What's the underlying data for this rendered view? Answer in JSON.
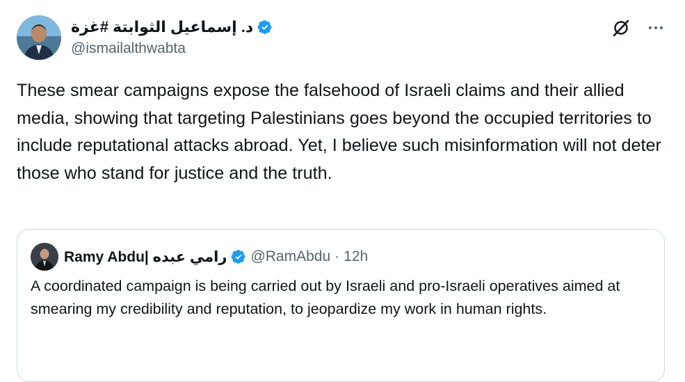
{
  "tweet": {
    "author": {
      "display_name": "د. إسماعيل الثوابتة #غزة",
      "handle": "@ismailalthwabta",
      "verified": true,
      "avatar": "profile-photo"
    },
    "actions": {
      "grok_icon": "grok-icon",
      "more_icon": "more-options-icon"
    },
    "text": "These smear campaigns expose the falsehood of Israeli claims and their allied media, showing that targeting Palestinians goes beyond the occupied territories to include reputational attacks abroad. Yet, I believe such misinformation will not deter those who stand for justice and the truth."
  },
  "quoted_tweet": {
    "display_name": "Ramy Abdu| رامي عبده",
    "verified": true,
    "handle": "@RamAbdu",
    "separator": "·",
    "time": "12h",
    "text": "A coordinated campaign is being carried out by Israeli and pro-Israeli operatives aimed at smearing my credibility and reputation, to jeopardize my work in human rights."
  },
  "colors": {
    "text_primary": "#0f1419",
    "text_secondary": "#536471",
    "verified_blue": "#1d9bf0",
    "border": "#cfd9de",
    "background": "#ffffff"
  }
}
